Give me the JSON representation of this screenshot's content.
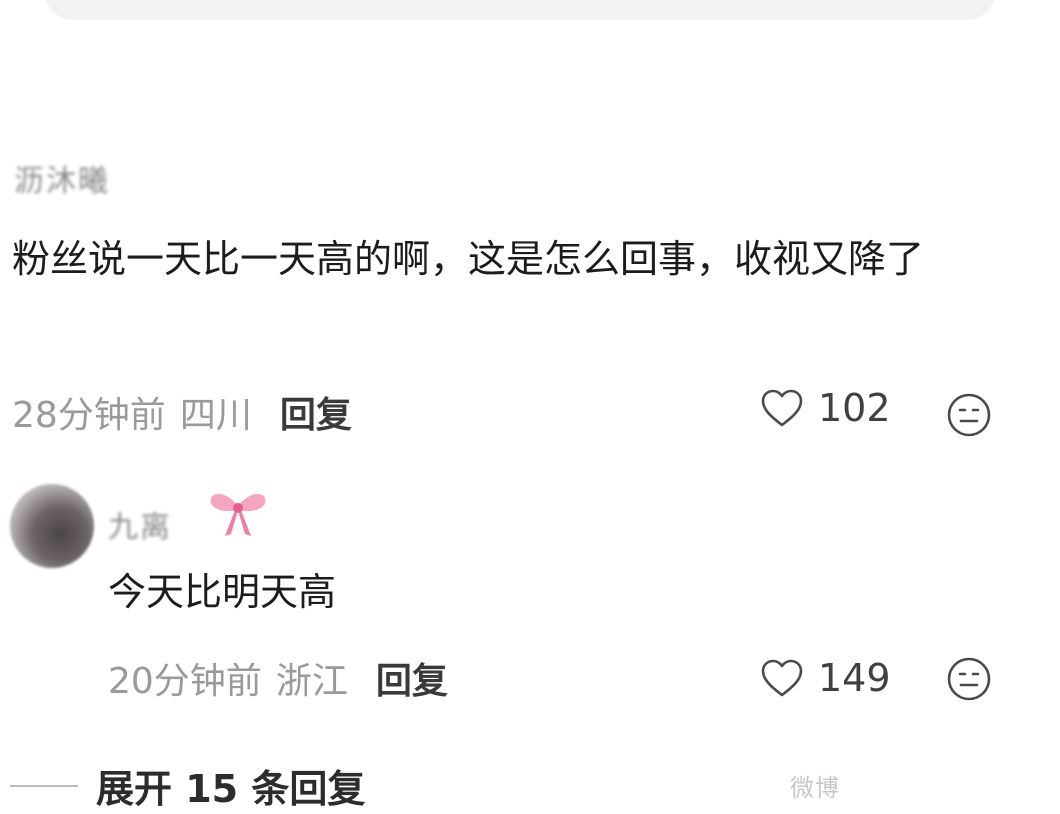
{
  "comments": [
    {
      "username": "沥沐曦",
      "text": "粉丝说一天比一天高的啊，这是怎么回事，收视又降了",
      "time": "28分钟前",
      "location": "四川",
      "reply_label": "回复",
      "likes": "102"
    },
    {
      "username": "九离",
      "text": "今天比明天高",
      "time": "20分钟前",
      "location": "浙江",
      "reply_label": "回复",
      "likes": "149"
    }
  ],
  "expand": {
    "label": "展开 15 条回复"
  },
  "watermark": "微博"
}
